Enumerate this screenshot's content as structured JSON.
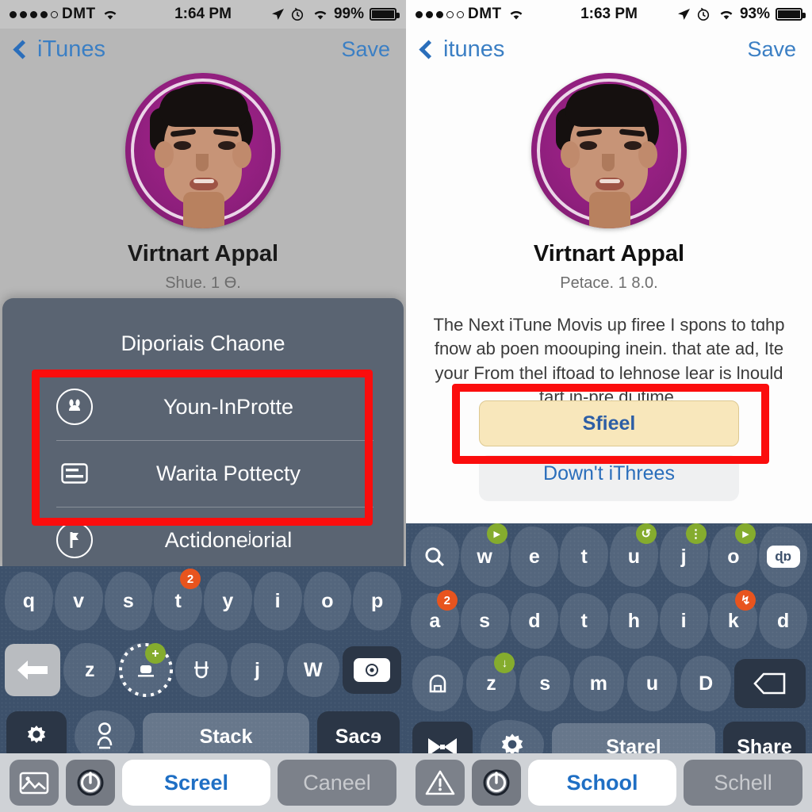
{
  "left": {
    "status": {
      "carrier": "DMT",
      "signal_filled": 4,
      "signal_total": 5,
      "time": "1:64 PM",
      "battery": "99%"
    },
    "nav": {
      "back_label": "iTunes",
      "save_label": "Save"
    },
    "profile": {
      "name": "Virtnart Appal",
      "subtitle": "Shue. 1 Ɵ."
    },
    "sheet": {
      "title": "Diporiais Chaone",
      "items": [
        {
          "label": "Youn-InProtte",
          "icon": "face-circle-icon"
        },
        {
          "label": "Warita Pottecty",
          "icon": "card-lines-icon"
        },
        {
          "label": "Actidoneʲorial",
          "icon": "flag-circle-icon"
        }
      ]
    },
    "keyboard": {
      "row1": [
        "q",
        "v",
        "s",
        "t",
        "y",
        "i",
        "o",
        "p"
      ],
      "row1_badges": {
        "t": "2"
      },
      "row2": [
        "←",
        "z",
        "␣",
        "Ʉ",
        "j",
        "W",
        "⊙"
      ],
      "bottom": {
        "gear": "gear-icon",
        "person": "person-icon",
        "space_label": "Stack",
        "return_label": "Sacɘ"
      }
    },
    "toolbar": {
      "icon1": "photo-icon",
      "icon2": "power-icon",
      "primary_label": "Screel",
      "secondary_label": "Caneel"
    },
    "highlight_color": "#fb0d0d"
  },
  "right": {
    "status": {
      "carrier": "DMT",
      "signal_filled": 3,
      "signal_total": 5,
      "time": "1:63 PM",
      "battery": "93%"
    },
    "nav": {
      "back_label": "itunes",
      "save_label": "Save"
    },
    "profile": {
      "name": "Virtnart Appal",
      "subtitle": "Petace. 1 8.0."
    },
    "body_text": "The Next iTune Movis up firee I spons to tɑhp fnow ab poen moouping inein. that ate ad, Ite your From thel iftoad to lehnose lear is lnould tart in-pre di itime.",
    "primary_button": "Sfieel",
    "secondary_link": "Down't iThrees",
    "keyboard": {
      "row1": [
        "⌕",
        "w",
        "e",
        "t",
        "u",
        "j",
        "o",
        "⌗"
      ],
      "row2": [
        "a",
        "s",
        "d",
        "t",
        "h",
        "i",
        "k",
        "d"
      ],
      "row3": [
        "⌂",
        "z",
        "s",
        "m",
        "u",
        "D",
        "⌫"
      ],
      "bottom": {
        "icon1": "bowtie-icon",
        "icon2": "gear-icon",
        "space_label": "Starel",
        "return_label": "Share"
      }
    },
    "toolbar": {
      "icon1": "warning-icon",
      "icon2": "power-icon",
      "primary_label": "School",
      "secondary_label": "Schell"
    },
    "highlight_color": "#fb0d0d"
  }
}
